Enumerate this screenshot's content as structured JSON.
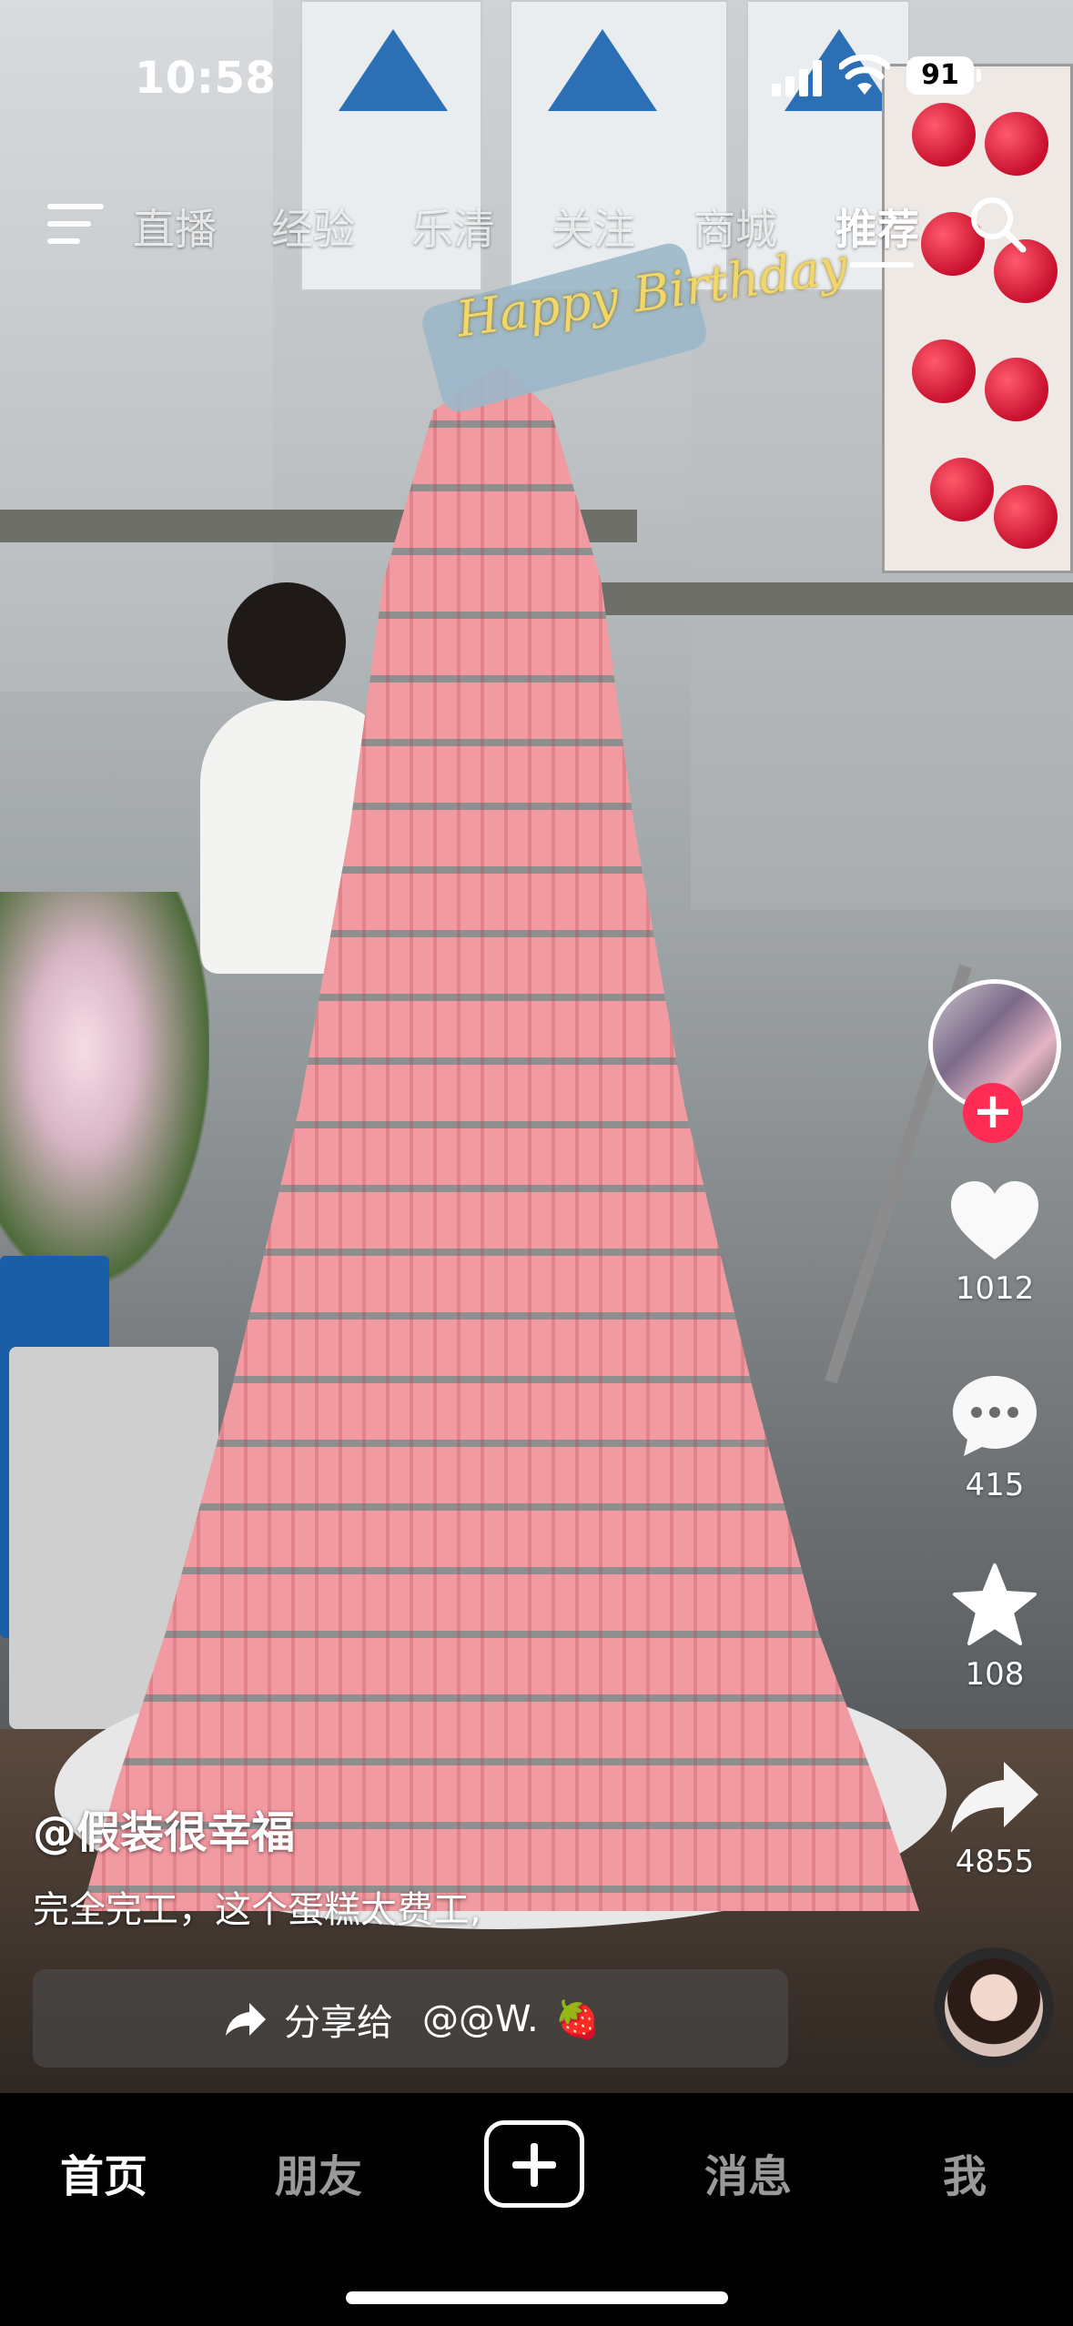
{
  "status_bar": {
    "time": "10:58",
    "battery": "91"
  },
  "top_nav": {
    "tabs": [
      {
        "label": "直播"
      },
      {
        "label": "经验"
      },
      {
        "label": "乐清"
      },
      {
        "label": "关注"
      },
      {
        "label": "商城"
      },
      {
        "label": "推荐"
      }
    ],
    "active_tab": "推荐"
  },
  "video": {
    "topper_text": "Happy Birthday"
  },
  "actions": {
    "likes": "1012",
    "comments": "415",
    "favorites": "108",
    "shares": "4855"
  },
  "caption": {
    "author": "@假装很幸福",
    "description": "完全完工，这个蛋糕太费工,",
    "share_label": "分享给",
    "share_target": "@@W.",
    "share_emoji": "🍓"
  },
  "bottom_nav": {
    "tabs": [
      {
        "label": "首页"
      },
      {
        "label": "朋友"
      },
      {
        "label": "消息"
      },
      {
        "label": "我"
      }
    ],
    "active_tab": "首页"
  },
  "colors": {
    "follow_button": "#fe2c55",
    "background": "#000000"
  }
}
